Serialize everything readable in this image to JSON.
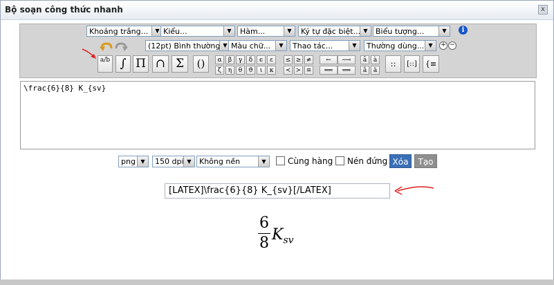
{
  "dialog": {
    "title": "Bộ soạn công thức nhanh",
    "close_glyph": "x"
  },
  "toolbar": {
    "row1": [
      {
        "name": "dropdown-spacing",
        "label": "Khoảng trắng..."
      },
      {
        "name": "dropdown-style",
        "label": "Kiểu..."
      },
      {
        "name": "dropdown-functions",
        "label": "Hàm..."
      },
      {
        "name": "dropdown-special-chars",
        "label": "Ký tự đặc biệt..."
      },
      {
        "name": "dropdown-symbols",
        "label": "Biểu tượng..."
      }
    ],
    "row2": [
      {
        "name": "dropdown-font-size",
        "label": "(12pt) Bình thường"
      },
      {
        "name": "dropdown-color",
        "label": "Màu chữ..."
      },
      {
        "name": "dropdown-operations",
        "label": "Thao tác..."
      },
      {
        "name": "dropdown-common",
        "label": "Thường dùng..."
      }
    ],
    "zoom_in": "+",
    "zoom_out": "−",
    "info": "i",
    "big_buttons": [
      "a/b",
      "∫",
      "Π",
      "∩",
      "Σ",
      "()"
    ],
    "greek_row1": [
      "α",
      "β",
      "γ",
      "δ",
      "ϵ",
      "ε"
    ],
    "greek_row2": [
      "ζ",
      "η",
      "θ",
      "ϑ",
      "ι",
      "κ"
    ],
    "rel_row1": [
      "≤",
      "≥",
      "≠"
    ],
    "rel_row2": [
      "≺",
      "≻",
      "≡"
    ],
    "arrows_row1": [
      "←",
      "⟶"
    ],
    "arrows_row2": [
      "⟸",
      "⟹"
    ],
    "accent_row1": [
      "â",
      "à"
    ],
    "accent_row2": [
      "ã",
      "ä"
    ],
    "matrix_buttons": [
      "::",
      "[::]",
      "{≡"
    ]
  },
  "editor": {
    "latex": "\\frac{6}{8} K_{sv}"
  },
  "options": {
    "format": "png",
    "dpi": "150 dpi",
    "background": "Không nền",
    "same_line_label": "Cùng hàng",
    "compress_label": "Nén đứng",
    "clear_label": "Xóa",
    "create_label": "Tạo"
  },
  "output": {
    "code": "[LATEX]\\frac{6}{8} K_{sv}[/LATEX]"
  },
  "preview": {
    "numerator": "6",
    "denominator": "8",
    "base": "K",
    "subscript": "sv"
  },
  "colors": {
    "accent": "#3b6fb6",
    "annotation": "#e02020"
  }
}
